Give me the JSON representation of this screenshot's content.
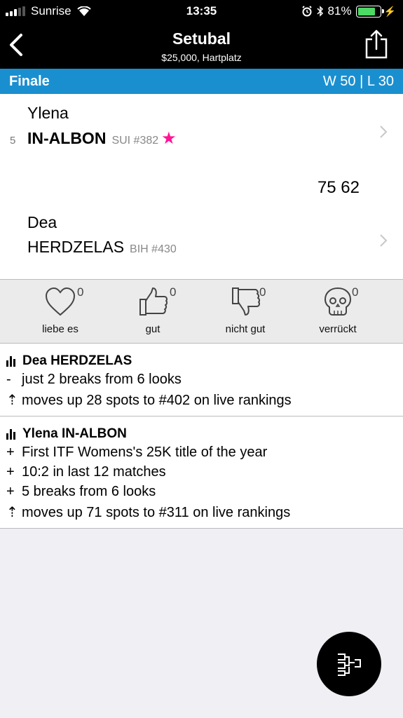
{
  "status_bar": {
    "carrier": "Sunrise",
    "time": "13:35",
    "battery": "81%",
    "battery_level": 0.81,
    "icons": [
      "signal-icon",
      "wifi-icon",
      "alarm-icon",
      "bluetooth-icon",
      "battery-icon",
      "charging-icon"
    ]
  },
  "nav": {
    "title": "Setubal",
    "subtitle": "$25,000, Hartplatz",
    "back_icon": "chevron-left-icon",
    "share_icon": "share-icon"
  },
  "round": {
    "name": "Finale",
    "record": "W 50 | L 30"
  },
  "match": {
    "player1": {
      "seed": "5",
      "first_name": "Ylena",
      "last_name": "IN-ALBON",
      "meta": "SUI #382",
      "favorite": true
    },
    "score": "75 62",
    "player2": {
      "first_name": "Dea",
      "last_name": "HERDZELAS",
      "meta": "BIH #430"
    }
  },
  "reactions": [
    {
      "icon": "heart-icon",
      "label": "liebe es",
      "count": "0"
    },
    {
      "icon": "thumbs-up-icon",
      "label": "gut",
      "count": "0"
    },
    {
      "icon": "thumbs-down-icon",
      "label": "nicht gut",
      "count": "0"
    },
    {
      "icon": "skull-icon",
      "label": "verrückt",
      "count": "0"
    }
  ],
  "stats": [
    {
      "player": "Dea HERDZELAS",
      "lines": [
        {
          "mark": "-",
          "text": "just 2 breaks from 6 looks"
        },
        {
          "mark": "⇡",
          "text": "moves up 28 spots to #402 on live rankings"
        }
      ]
    },
    {
      "player": "Ylena IN-ALBON",
      "lines": [
        {
          "mark": "+",
          "text": "First ITF Womens's 25K title of the year"
        },
        {
          "mark": "+",
          "text": "10:2 in last 12 matches"
        },
        {
          "mark": "+",
          "text": "5 breaks from 6 looks"
        },
        {
          "mark": "⇡",
          "text": "moves up 71 spots to #311 on live rankings"
        }
      ]
    }
  ],
  "colors": {
    "accent": "#1a8fd0",
    "favorite_star": "#ff1493",
    "battery": "#4cd964"
  },
  "fab_icon": "bracket-icon"
}
